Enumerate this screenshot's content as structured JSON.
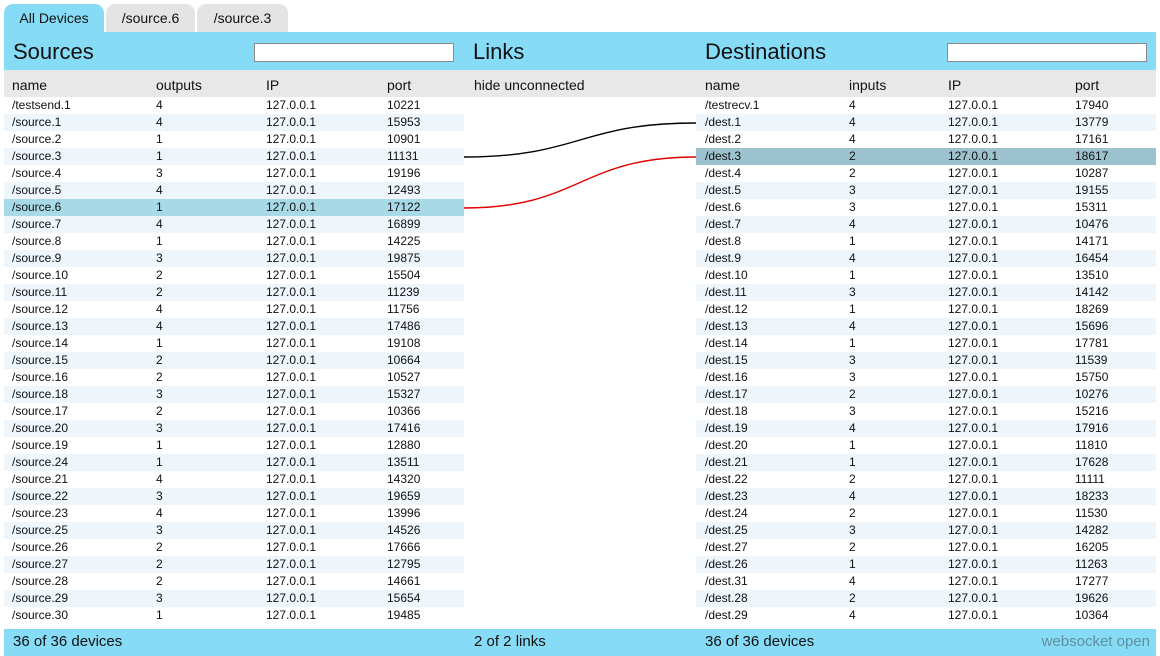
{
  "tabs": [
    "All Devices",
    "/source.6",
    "/source.3"
  ],
  "sources": {
    "title": "Sources",
    "columns": [
      "name",
      "outputs",
      "IP",
      "port"
    ],
    "rows": [
      [
        "/testsend.1",
        "4",
        "127.0.0.1",
        "10221"
      ],
      [
        "/source.1",
        "4",
        "127.0.0.1",
        "15953"
      ],
      [
        "/source.2",
        "1",
        "127.0.0.1",
        "10901"
      ],
      [
        "/source.3",
        "1",
        "127.0.0.1",
        "11131"
      ],
      [
        "/source.4",
        "3",
        "127.0.0.1",
        "19196"
      ],
      [
        "/source.5",
        "4",
        "127.0.0.1",
        "12493"
      ],
      [
        "/source.6",
        "1",
        "127.0.0.1",
        "17122"
      ],
      [
        "/source.7",
        "4",
        "127.0.0.1",
        "16899"
      ],
      [
        "/source.8",
        "1",
        "127.0.0.1",
        "14225"
      ],
      [
        "/source.9",
        "3",
        "127.0.0.1",
        "19875"
      ],
      [
        "/source.10",
        "2",
        "127.0.0.1",
        "15504"
      ],
      [
        "/source.11",
        "2",
        "127.0.0.1",
        "11239"
      ],
      [
        "/source.12",
        "4",
        "127.0.0.1",
        "11756"
      ],
      [
        "/source.13",
        "4",
        "127.0.0.1",
        "17486"
      ],
      [
        "/source.14",
        "1",
        "127.0.0.1",
        "19108"
      ],
      [
        "/source.15",
        "2",
        "127.0.0.1",
        "10664"
      ],
      [
        "/source.16",
        "2",
        "127.0.0.1",
        "10527"
      ],
      [
        "/source.18",
        "3",
        "127.0.0.1",
        "15327"
      ],
      [
        "/source.17",
        "2",
        "127.0.0.1",
        "10366"
      ],
      [
        "/source.20",
        "3",
        "127.0.0.1",
        "17416"
      ],
      [
        "/source.19",
        "1",
        "127.0.0.1",
        "12880"
      ],
      [
        "/source.24",
        "1",
        "127.0.0.1",
        "13511"
      ],
      [
        "/source.21",
        "4",
        "127.0.0.1",
        "14320"
      ],
      [
        "/source.22",
        "3",
        "127.0.0.1",
        "19659"
      ],
      [
        "/source.23",
        "4",
        "127.0.0.1",
        "13996"
      ],
      [
        "/source.25",
        "3",
        "127.0.0.1",
        "14526"
      ],
      [
        "/source.26",
        "2",
        "127.0.0.1",
        "17666"
      ],
      [
        "/source.27",
        "2",
        "127.0.0.1",
        "12795"
      ],
      [
        "/source.28",
        "2",
        "127.0.0.1",
        "14661"
      ],
      [
        "/source.29",
        "3",
        "127.0.0.1",
        "15654"
      ],
      [
        "/source.30",
        "1",
        "127.0.0.1",
        "19485"
      ]
    ],
    "selected_row": "/source.6",
    "footer": "36 of 36 devices"
  },
  "links": {
    "title": "Links",
    "filter_label": "hide unconnected",
    "footer": "2 of 2 links",
    "connections": [
      {
        "from": "/source.3",
        "to": "/dest.1",
        "color": "#000000"
      },
      {
        "from": "/source.6",
        "to": "/dest.3",
        "color": "#e00000"
      }
    ]
  },
  "destinations": {
    "title": "Destinations",
    "columns": [
      "name",
      "inputs",
      "IP",
      "port"
    ],
    "rows": [
      [
        "/testrecv.1",
        "4",
        "127.0.0.1",
        "17940"
      ],
      [
        "/dest.1",
        "4",
        "127.0.0.1",
        "13779"
      ],
      [
        "/dest.2",
        "4",
        "127.0.0.1",
        "17161"
      ],
      [
        "/dest.3",
        "2",
        "127.0.0.1",
        "18617"
      ],
      [
        "/dest.4",
        "2",
        "127.0.0.1",
        "10287"
      ],
      [
        "/dest.5",
        "3",
        "127.0.0.1",
        "19155"
      ],
      [
        "/dest.6",
        "3",
        "127.0.0.1",
        "15311"
      ],
      [
        "/dest.7",
        "4",
        "127.0.0.1",
        "10476"
      ],
      [
        "/dest.8",
        "1",
        "127.0.0.1",
        "14171"
      ],
      [
        "/dest.9",
        "4",
        "127.0.0.1",
        "16454"
      ],
      [
        "/dest.10",
        "1",
        "127.0.0.1",
        "13510"
      ],
      [
        "/dest.11",
        "3",
        "127.0.0.1",
        "14142"
      ],
      [
        "/dest.12",
        "1",
        "127.0.0.1",
        "18269"
      ],
      [
        "/dest.13",
        "4",
        "127.0.0.1",
        "15696"
      ],
      [
        "/dest.14",
        "1",
        "127.0.0.1",
        "17781"
      ],
      [
        "/dest.15",
        "3",
        "127.0.0.1",
        "11539"
      ],
      [
        "/dest.16",
        "3",
        "127.0.0.1",
        "15750"
      ],
      [
        "/dest.17",
        "2",
        "127.0.0.1",
        "10276"
      ],
      [
        "/dest.18",
        "3",
        "127.0.0.1",
        "15216"
      ],
      [
        "/dest.19",
        "4",
        "127.0.0.1",
        "17916"
      ],
      [
        "/dest.20",
        "1",
        "127.0.0.1",
        "11810"
      ],
      [
        "/dest.21",
        "1",
        "127.0.0.1",
        "17628"
      ],
      [
        "/dest.22",
        "2",
        "127.0.0.1",
        "11111"
      ],
      [
        "/dest.23",
        "4",
        "127.0.0.1",
        "18233"
      ],
      [
        "/dest.24",
        "2",
        "127.0.0.1",
        "11530"
      ],
      [
        "/dest.25",
        "3",
        "127.0.0.1",
        "14282"
      ],
      [
        "/dest.27",
        "2",
        "127.0.0.1",
        "16205"
      ],
      [
        "/dest.26",
        "1",
        "127.0.0.1",
        "11263"
      ],
      [
        "/dest.31",
        "4",
        "127.0.0.1",
        "17277"
      ],
      [
        "/dest.28",
        "2",
        "127.0.0.1",
        "19626"
      ],
      [
        "/dest.29",
        "4",
        "127.0.0.1",
        "10364"
      ]
    ],
    "selected_row": "/dest.3",
    "footer": "36 of 36 devices"
  },
  "status": "websocket open",
  "colors": {
    "header_bar": "#86dcf6",
    "selected_source": "#a8d9e6",
    "selected_dest": "#9cc2d0",
    "link_default": "#000000",
    "link_selected": "#e00000"
  }
}
